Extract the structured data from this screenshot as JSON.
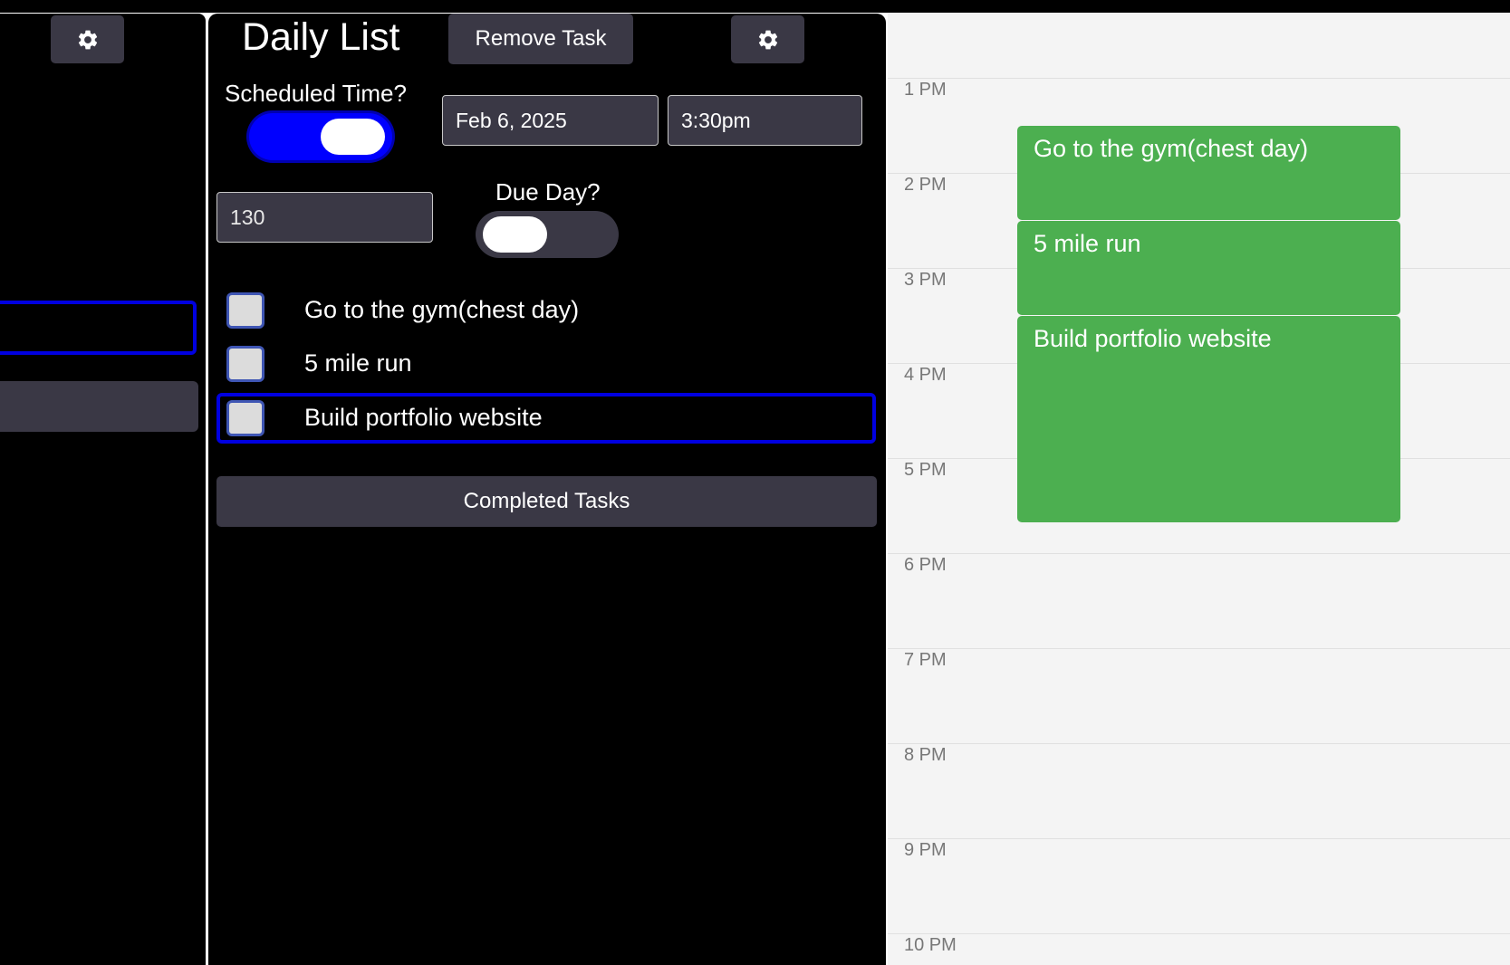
{
  "main": {
    "title": "Daily List",
    "remove_task_label": "Remove Task",
    "scheduled_time_label": "Scheduled Time?",
    "scheduled_time_on": true,
    "date_value": "Feb 6, 2025",
    "time_value": "3:30pm",
    "duration_value": "130",
    "due_day_label": "Due Day?",
    "due_day_on": false,
    "tasks": [
      {
        "label": "Go to the gym(chest day)",
        "checked": false
      },
      {
        "label": "5 mile run",
        "checked": false
      },
      {
        "label": "Build portfolio website",
        "checked": false,
        "selected": true
      }
    ],
    "completed_tasks_label": "Completed Tasks"
  },
  "icons": {
    "settings": "gear-icon"
  },
  "colors": {
    "accent": "#0000ff",
    "event": "#4caf50",
    "panel": "#000000",
    "button": "#3a3845"
  },
  "calendar": {
    "hours": [
      "1 PM",
      "2 PM",
      "3 PM",
      "4 PM",
      "5 PM",
      "6 PM",
      "7 PM",
      "8 PM",
      "9 PM",
      "10 PM"
    ],
    "events": [
      {
        "title": "Go to the gym(chest day)"
      },
      {
        "title": "5 mile run"
      },
      {
        "title": "Build portfolio website"
      }
    ]
  }
}
